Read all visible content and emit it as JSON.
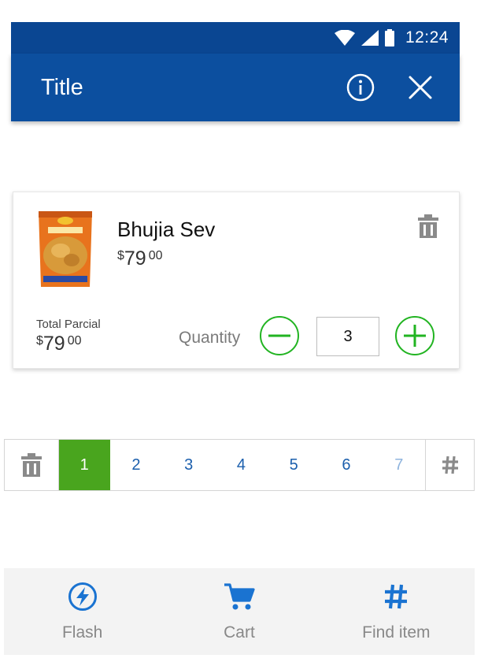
{
  "status_bar": {
    "time": "12:24"
  },
  "app_bar": {
    "title": "Title"
  },
  "product": {
    "name": "Bhujia Sev",
    "price": {
      "currency": "$",
      "integer": "79",
      "cents": "00"
    },
    "subtotal_label": "Total Parcial",
    "subtotal": {
      "currency": "$",
      "integer": "79",
      "cents": "00"
    },
    "quantity_label": "Quantity",
    "quantity": "3"
  },
  "pagination": {
    "pages": [
      "1",
      "2",
      "3",
      "4",
      "5",
      "6",
      "7"
    ],
    "active_page": "1",
    "jump_symbol": "#"
  },
  "bottom_nav": {
    "items": [
      {
        "label": "Flash",
        "icon": "flash-icon"
      },
      {
        "label": "Cart",
        "icon": "cart-icon"
      },
      {
        "label": "Find item",
        "icon": "hash-icon"
      }
    ]
  },
  "colors": {
    "app_bar": "#0c4f9f",
    "status_bar": "#0a4692",
    "active_page": "#49a51e",
    "quantity_controls": "#22b422",
    "link_blue": "#1b5fad"
  }
}
